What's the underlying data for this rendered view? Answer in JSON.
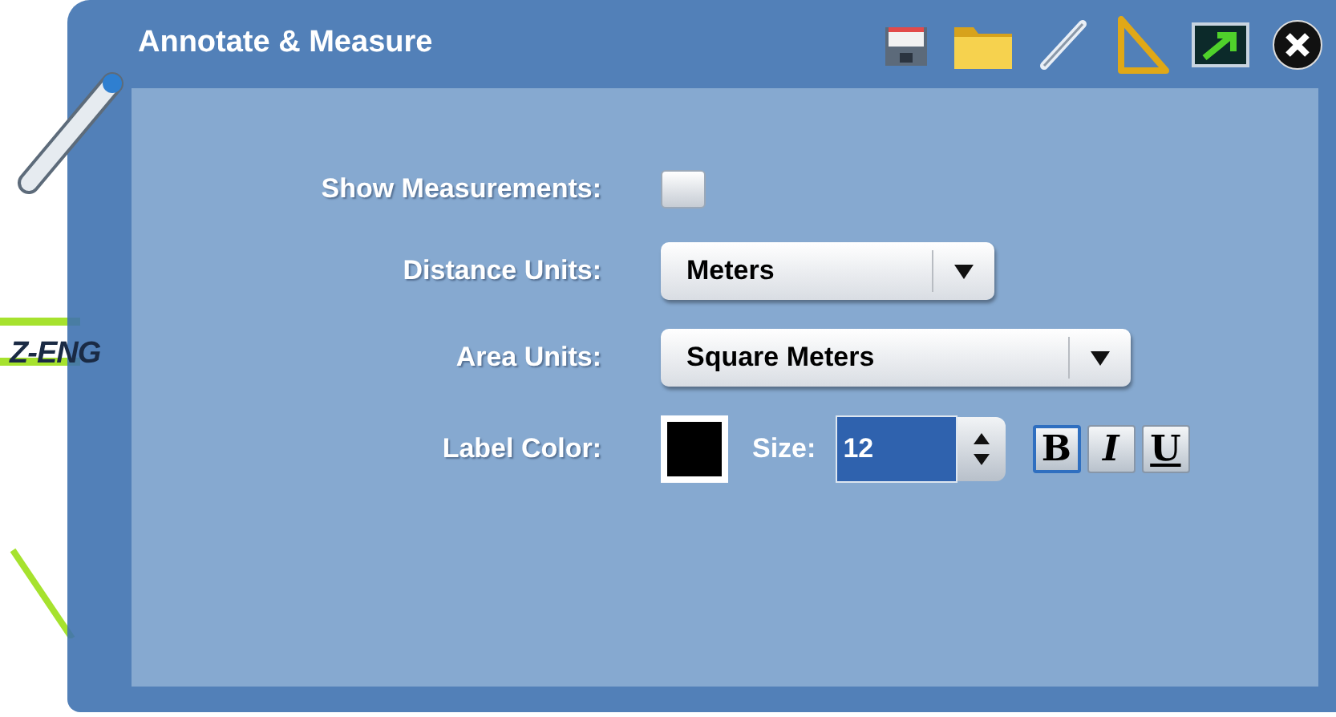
{
  "map": {
    "road_label": "Z-ENG"
  },
  "window": {
    "title": "Annotate & Measure"
  },
  "form": {
    "show_measurements": {
      "label": "Show Measurements:",
      "checked": false
    },
    "distance_units": {
      "label": "Distance Units:",
      "value": "Meters"
    },
    "area_units": {
      "label": "Area Units:",
      "value": "Square Meters"
    },
    "label_color": {
      "label": "Label Color:",
      "color": "#000000"
    },
    "size": {
      "label": "Size:",
      "value": "12"
    },
    "styles": [
      {
        "kind": "bold",
        "label": "B",
        "selected": true
      },
      {
        "kind": "italic",
        "label": "I",
        "selected": false
      },
      {
        "kind": "underline",
        "label": "U",
        "selected": false
      }
    ]
  }
}
